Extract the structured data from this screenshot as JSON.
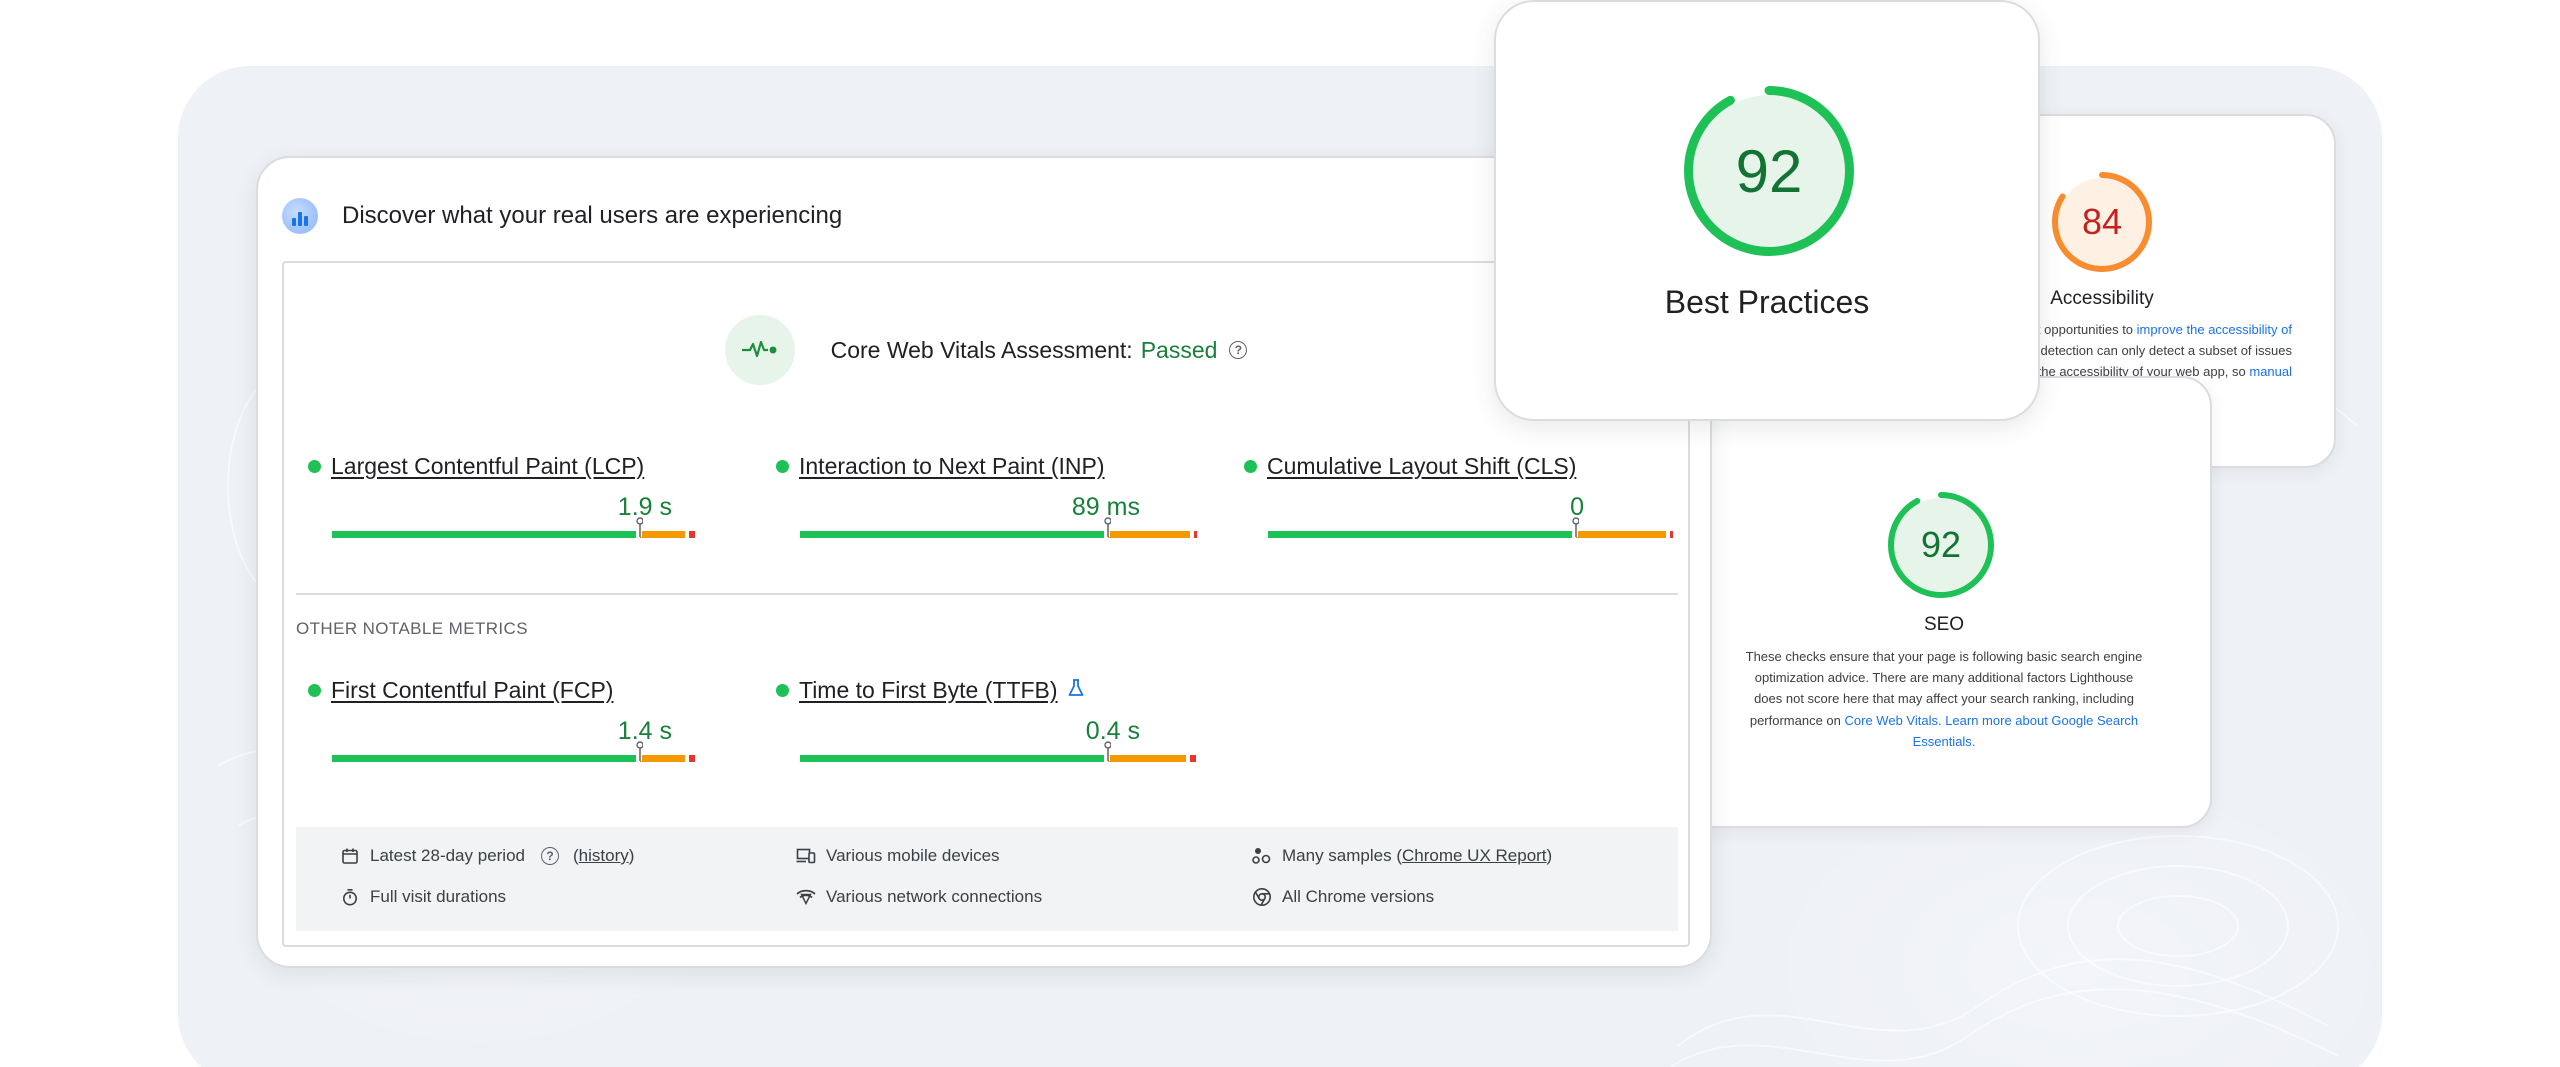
{
  "crux": {
    "title": "Discover what your real users are experiencing",
    "assessment_label": "Core Web Vitals Assessment:",
    "assessment_status": "Passed",
    "help_glyph": "?",
    "other_metrics_label": "OTHER NOTABLE METRICS",
    "metrics": [
      {
        "name": "Largest Contentful Paint (LCP)",
        "value": "1.9 s",
        "status_color": "#1ec156",
        "marker_fraction": 0.75,
        "good": 0.75,
        "ni": 0.12,
        "poor": 0.025
      },
      {
        "name": "Interaction to Next Paint (INP)",
        "value": "89 ms",
        "status_color": "#1ec156",
        "marker_fraction": 0.75,
        "good": 0.75,
        "ni": 0.21,
        "poor": 0.015
      },
      {
        "name": "Cumulative Layout Shift (CLS)",
        "value": "0",
        "status_color": "#1ec156",
        "marker_fraction": 0.75,
        "good": 0.75,
        "ni": 0.23,
        "poor": 0.005
      },
      {
        "name": "First Contentful Paint (FCP)",
        "value": "1.4 s",
        "status_color": "#1ec156",
        "marker_fraction": 0.75,
        "good": 0.75,
        "ni": 0.12,
        "poor": 0.025
      },
      {
        "name": "Time to First Byte (TTFB)",
        "value": "0.4 s",
        "status_color": "#1ec156",
        "marker_fraction": 0.75,
        "good": 0.75,
        "ni": 0.2,
        "poor": 0.025
      }
    ],
    "info": {
      "period": "Latest 28-day period",
      "history_link": "history",
      "devices": "Various mobile devices",
      "samples_prefix": "Many samples (",
      "samples_link": "Chrome UX Report",
      "samples_suffix": ")",
      "durations": "Full visit durations",
      "network": "Various network connections",
      "versions": "All Chrome versions"
    }
  },
  "best_practices": {
    "score": "92",
    "fraction": 0.92,
    "label": "Best Practices",
    "color": "#1ec156",
    "text_color": "#137333",
    "fill": "#e6f4ea"
  },
  "accessibility": {
    "score": "84",
    "fraction": 0.84,
    "label": "Accessibility",
    "color": "#fa8c30",
    "text_color": "#c5221f",
    "fill": "#fef0e3",
    "desc_line1_prefix": "t opportunities to ",
    "desc_line1_link": "improve the accessibility of",
    "desc_line2": "c detection can only detect a subset of issues",
    "desc_line3_prefix": "e the accessibility of your web app, so ",
    "desc_line3_link": "manual"
  },
  "seo": {
    "score": "92",
    "fraction": 0.92,
    "label": "SEO",
    "color": "#1ec156",
    "text_color": "#137333",
    "fill": "#e6f4ea",
    "desc_line1": "These checks ensure that your page is following basic search engine",
    "desc_line2": "optimization advice. There are many additional factors Lighthouse",
    "desc_line3": "does not score here that may affect your search ranking, including",
    "desc_line4_prefix": "performance on ",
    "desc_line4_link": "Core Web Vitals",
    "desc_line4_link2": ". Learn more about Google Search",
    "desc_line5_link": "Essentials",
    "desc_line5_suffix": "."
  },
  "colors": {
    "good": "#1ec156",
    "needs_improvement": "#f29900",
    "poor": "#e8352e",
    "link": "#1a73e8"
  }
}
